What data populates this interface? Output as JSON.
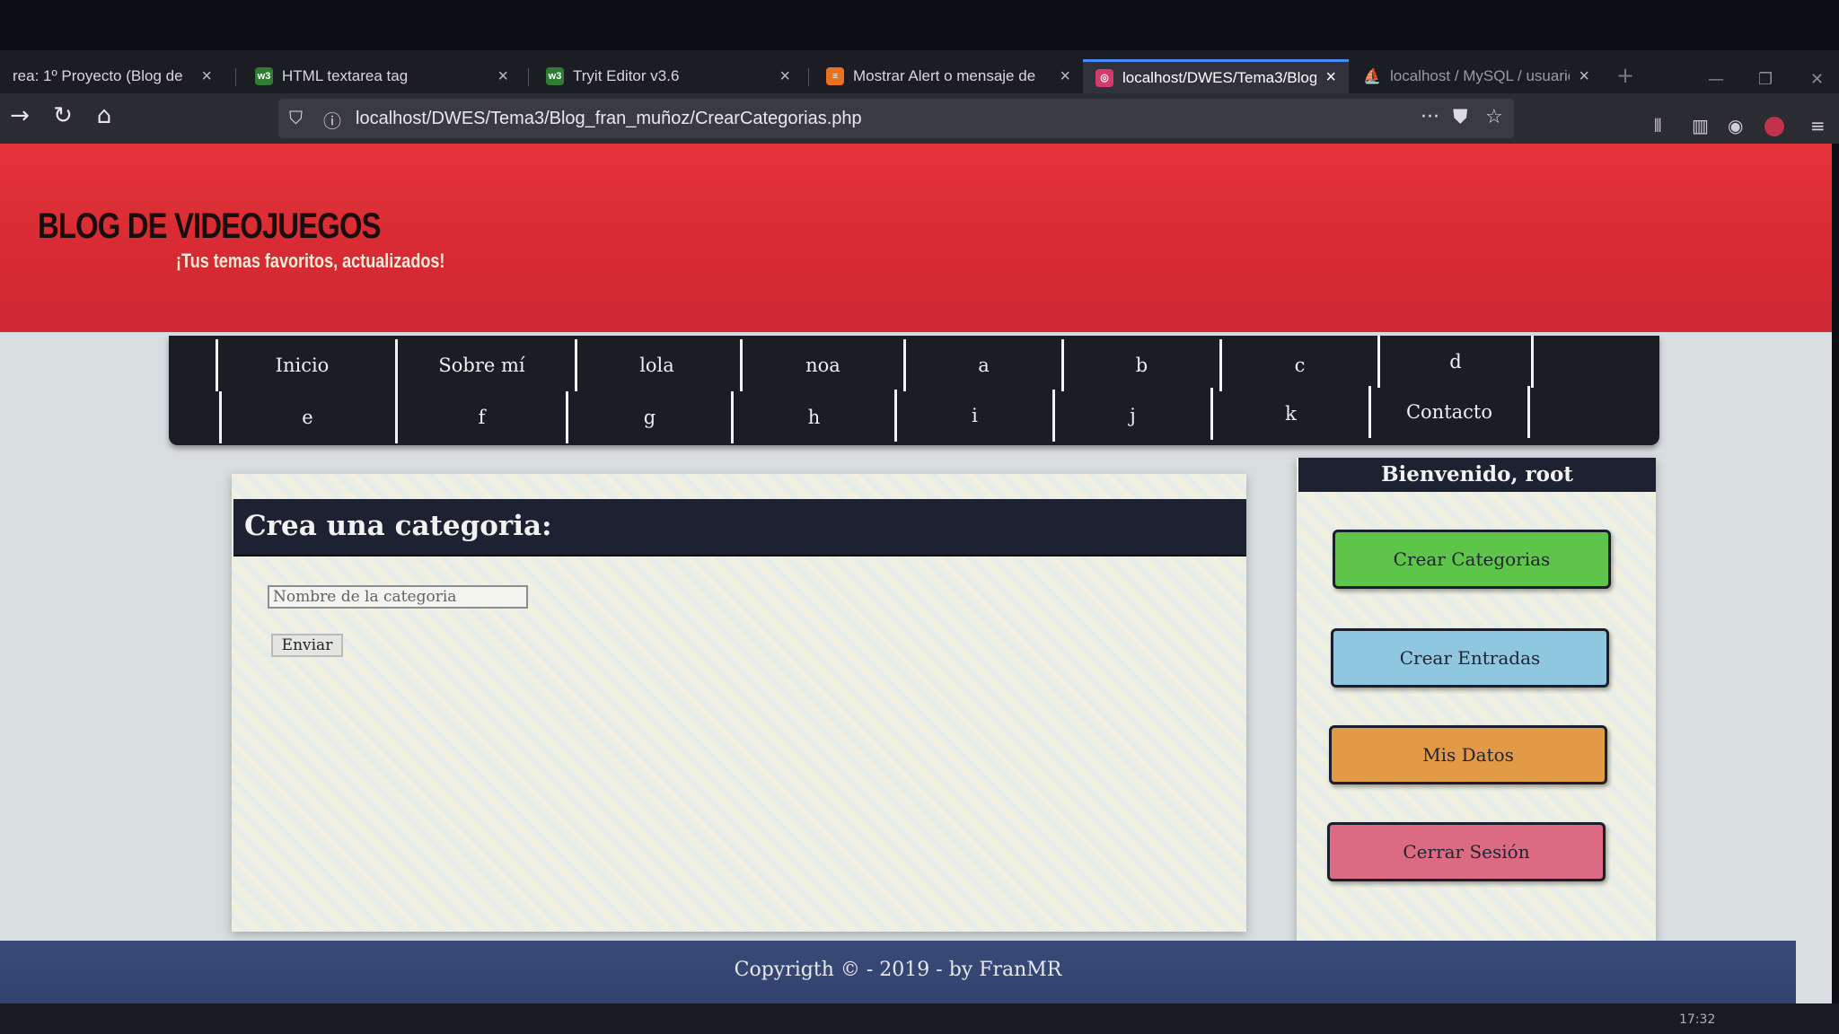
{
  "browser": {
    "tabs": [
      {
        "title": "rea: 1º Proyecto (Blog de",
        "icon": "page-icon",
        "active": false
      },
      {
        "title": "HTML textarea tag",
        "icon": "w3-icon",
        "active": false
      },
      {
        "title": "Tryit Editor v3.6",
        "icon": "w3-icon",
        "active": false
      },
      {
        "title": "Mostrar Alert o mensaje de",
        "icon": "stack-icon",
        "active": false
      },
      {
        "title": "localhost/DWES/Tema3/Blog_",
        "icon": "globe-icon",
        "active": true
      },
      {
        "title": "localhost / MySQL / usuaric",
        "icon": "phpmyadmin-icon",
        "active": false
      }
    ],
    "url": "localhost/DWES/Tema3/Blog_fran_muñoz/CrearCategorias.php",
    "clock": "17:32",
    "menu_dots": "···"
  },
  "header": {
    "title": "BLOG DE VIDEOJUEGOS",
    "subtitle": "¡Tus temas favoritos, actualizados!"
  },
  "menu": {
    "row1": [
      "Inicio",
      "Sobre mí",
      "lola",
      "noa",
      "a",
      "b",
      "c",
      "d"
    ],
    "row2": [
      "e",
      "f",
      "g",
      "h",
      "i",
      "j",
      "k",
      "Contacto"
    ]
  },
  "form": {
    "heading": "Crea una categoria:",
    "input_placeholder": "Nombre de la categoria",
    "submit_label": "Enviar"
  },
  "sidebar": {
    "welcome": "Bienvenido, root",
    "buttons": [
      {
        "label": "Crear Categorias",
        "color": "#5fc44a"
      },
      {
        "label": "Crear Entradas",
        "color": "#8fc6e0"
      },
      {
        "label": "Mis Datos",
        "color": "#e39a46"
      },
      {
        "label": "Cerrar Sesión",
        "color": "#dc6a82"
      }
    ]
  },
  "footer": {
    "text": "Copyrigth © - 2019 - by FranMR"
  }
}
